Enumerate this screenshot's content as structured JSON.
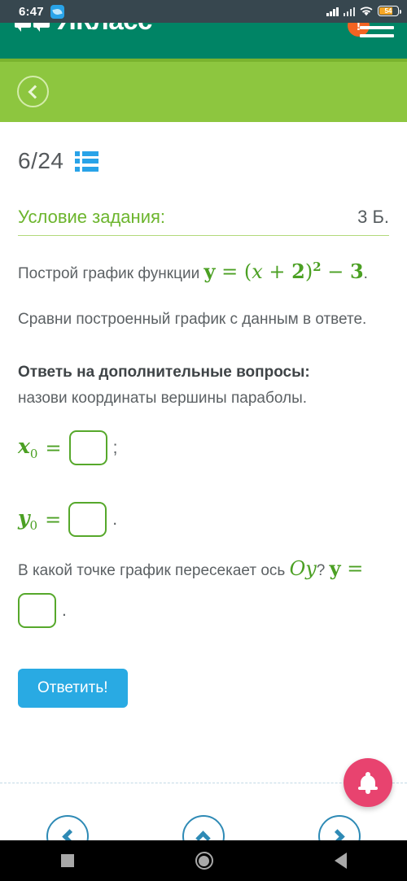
{
  "status_bar": {
    "time": "6:47",
    "app_icon": "message-app-icon",
    "signal_icon": "cellular-signal-icon",
    "signal_secondary_icon": "cellular-signal-secondary-icon",
    "wifi_icon": "wifi-icon",
    "battery_level": "54",
    "battery_icon": "battery-icon"
  },
  "header": {
    "logo_text": "ЯКласс",
    "logo_icon": "speech-bubbles-logo-icon",
    "notification_count": "!",
    "menu_icon": "hamburger-menu-icon",
    "back_icon": "chevron-left-icon",
    "brand_teal": "#008465",
    "brand_green": "#8dc63f"
  },
  "task": {
    "counter": "6/24",
    "list_icon": "task-list-icon",
    "condition_label": "Условие задания:",
    "points": "3 Б.",
    "prompt_prefix": "Построй график функции ",
    "formula": {
      "y": "y",
      "eq": "=",
      "open": "(",
      "x": "x",
      "plus": "+",
      "two": "2",
      "close": ")",
      "power": "2",
      "minus": "−",
      "three": "3",
      "period": "."
    },
    "compare_line": "Сравни построенный график с данным в ответе.",
    "extra_questions_title": "Ответь на дополнительные вопросы:",
    "extra_questions_sub": "назови координаты вершины параболы.",
    "x0_label": "x",
    "x0_sub": "0",
    "x0_eq": "=",
    "x0_value": "",
    "x0_punct": ";",
    "y0_label": "y",
    "y0_sub": "0",
    "y0_eq": "=",
    "y0_value": "",
    "y0_punct": ".",
    "oy_question_prefix": "В какой точке график пересекает ось ",
    "oy_axis": "Oy",
    "oy_question_suffix": "? ",
    "oy_y": "y",
    "oy_eq": "=",
    "oy_value": "",
    "oy_punct": ".",
    "submit_label": "Ответить!",
    "accent_green": "#4ba023",
    "input_border": "#56a82b",
    "submit_blue": "#29aae3"
  },
  "fab": {
    "icon": "notification-bell-icon",
    "color": "#e8436f"
  },
  "bottom_nav": {
    "prev_icon": "chevron-left-icon",
    "up_icon": "chevron-up-icon",
    "next_icon": "chevron-right-icon",
    "color": "#2e8ab5"
  },
  "android_nav": {
    "recents_icon": "square-recents-icon",
    "home_icon": "circle-home-icon",
    "back_icon": "triangle-back-icon"
  }
}
